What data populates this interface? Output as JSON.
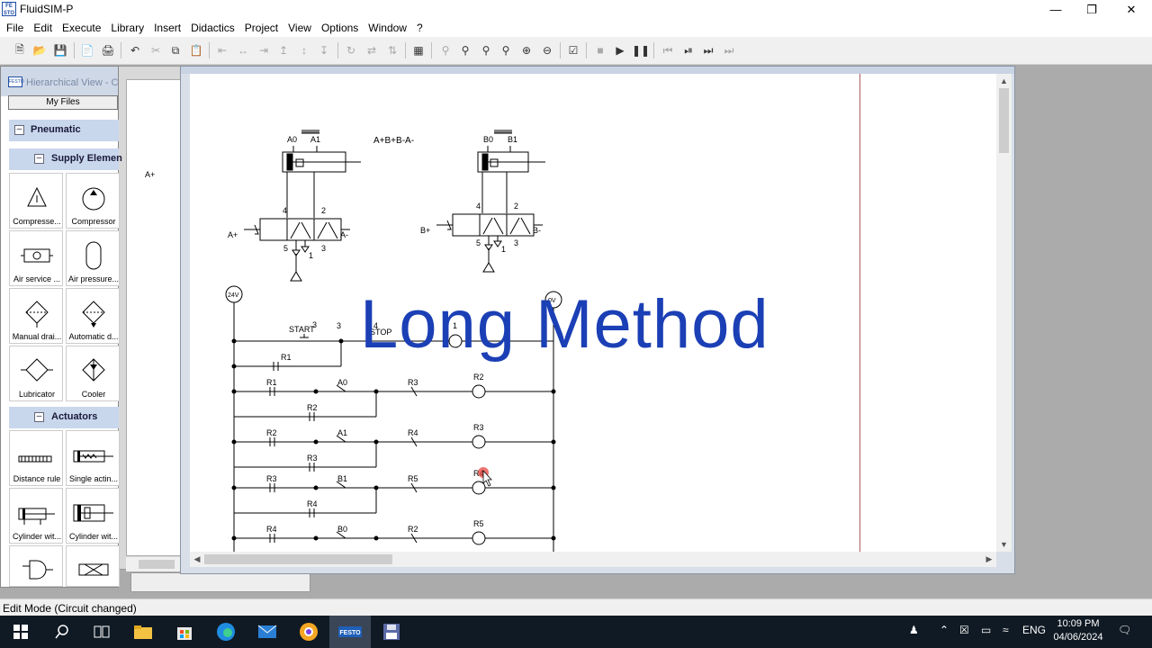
{
  "app": {
    "title": "FluidSIM-P",
    "logo_text": "FESTO"
  },
  "menu": [
    "File",
    "Edit",
    "Execute",
    "Library",
    "Insert",
    "Didactics",
    "Project",
    "View",
    "Options",
    "Window",
    "?"
  ],
  "library_panel": {
    "title": "Hierarchical View - C",
    "my_files_label": "My Files",
    "groups": [
      {
        "label": "Pneumatic"
      },
      {
        "label": "Supply Elemen"
      },
      {
        "label": "Actuators"
      }
    ],
    "tiles": [
      {
        "label": "Compresse...",
        "icon": "compressed-air-supply-icon"
      },
      {
        "label": "Compressor",
        "icon": "compressor-icon"
      },
      {
        "label": "Air service ...",
        "icon": "air-service-unit-icon"
      },
      {
        "label": "Air pressure...",
        "icon": "air-pressure-reservoir-icon"
      },
      {
        "label": "Manual drai...",
        "icon": "manual-drain-icon"
      },
      {
        "label": "Automatic d...",
        "icon": "automatic-drain-icon"
      },
      {
        "label": "Lubricator",
        "icon": "lubricator-icon"
      },
      {
        "label": "Cooler",
        "icon": "cooler-icon"
      },
      {
        "label": "Distance rule",
        "icon": "distance-rule-icon"
      },
      {
        "label": "Single actin...",
        "icon": "single-acting-cylinder-icon"
      },
      {
        "label": "Cylinder wit...",
        "icon": "cylinder-icon"
      },
      {
        "label": "Cylinder wit...",
        "icon": "cylinder-icon"
      }
    ]
  },
  "background_window": {
    "label_a_plus": "A+"
  },
  "circuit": {
    "sequence_label": "A+B+B-A-",
    "cylinder_a": {
      "sensor_left": "A0",
      "sensor_right": "A1"
    },
    "cylinder_b": {
      "sensor_left": "B0",
      "sensor_right": "B1"
    },
    "valve_a": {
      "left_solenoid": "A+",
      "right_solenoid": "A-",
      "port_4": "4",
      "port_2": "2",
      "port_5": "5",
      "port_3": "3",
      "port_1": "1"
    },
    "valve_b": {
      "left_solenoid": "B+",
      "right_solenoid": "B-",
      "port_4": "4",
      "port_2": "2",
      "port_5": "5",
      "port_3": "3",
      "port_1": "1"
    },
    "supply_24v": "24V",
    "supply_0v": "0V",
    "rung1": {
      "start_label": "START",
      "start_pin3": "3",
      "start_pin4": "4",
      "stop_label": "STOP",
      "stop_pin1": "1",
      "hold_contact": "R1"
    },
    "rung2": {
      "contact1": "R1",
      "sensor": "A0",
      "contact2": "R3",
      "coil": "R2",
      "hold_contact": "R2"
    },
    "rung3": {
      "contact1": "R2",
      "sensor": "A1",
      "contact2": "R4",
      "coil": "R3",
      "hold_contact": "R3"
    },
    "rung4": {
      "contact1": "R3",
      "sensor": "B1",
      "contact2": "R5",
      "coil": "R4",
      "hold_contact": "R4"
    },
    "rung5": {
      "contact1": "R4",
      "sensor": "B0",
      "contact2": "R2",
      "coil": "R5"
    }
  },
  "overlay_title": "Long Method",
  "status_bar": {
    "text": "Edit Mode (Circuit changed)"
  },
  "taskbar": {
    "language": "ENG",
    "time": "10:09 PM",
    "date": "04/06/2024"
  }
}
